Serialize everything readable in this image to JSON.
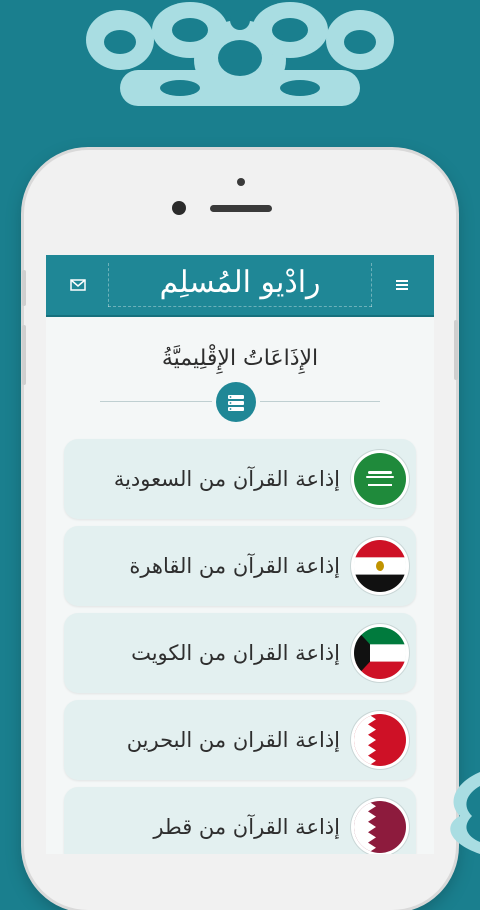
{
  "colors": {
    "background": "#1a7f8e",
    "appbar": "#1f8796",
    "item_bg": "#e3f0f0"
  },
  "appbar": {
    "title": "رادْيو المُسلِم",
    "left_icon": "mail-icon",
    "right_icon": "menu-icon"
  },
  "section": {
    "title": "الإِذَاعَاتُ الإِقْلِيميَّةُ",
    "badge_icon": "radio-list-icon"
  },
  "stations": [
    {
      "label": "إذاعة القرآن من السعودية",
      "flag": "saudi-arabia-flag-icon"
    },
    {
      "label": "إذاعة القرآن من القاهرة",
      "flag": "egypt-flag-icon"
    },
    {
      "label": "إذاعة القران من الكويت",
      "flag": "kuwait-flag-icon"
    },
    {
      "label": "إذاعة القران من البحرين",
      "flag": "bahrain-flag-icon"
    },
    {
      "label": "إذاعة القرآن من قطر",
      "flag": "qatar-flag-icon"
    }
  ]
}
